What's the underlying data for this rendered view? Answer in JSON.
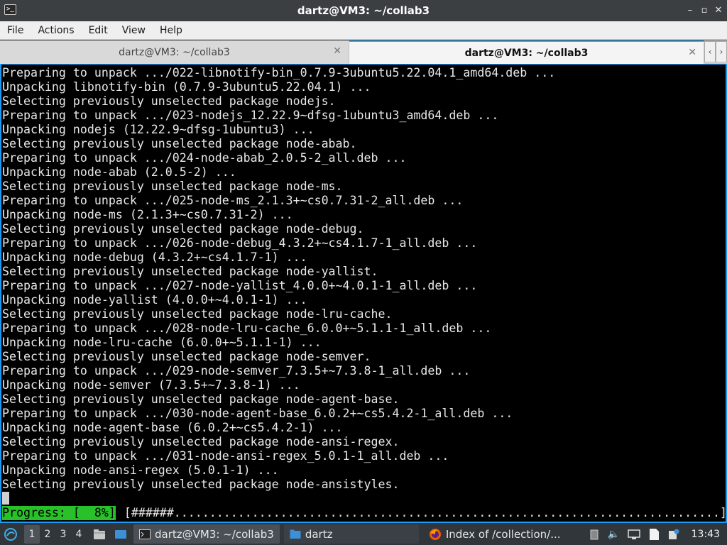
{
  "window": {
    "title": "dartz@VM3: ~/collab3",
    "controls": {
      "minimize": "–",
      "maximize": "▫",
      "close": "✕"
    }
  },
  "menu": [
    "File",
    "Actions",
    "Edit",
    "View",
    "Help"
  ],
  "tabs": [
    {
      "label": "dartz@VM3: ~/collab3",
      "active": false
    },
    {
      "label": "dartz@VM3: ~/collab3",
      "active": true
    }
  ],
  "tab_scroll": {
    "left": "‹",
    "right": "›"
  },
  "terminal": {
    "lines": [
      "Preparing to unpack .../022-libnotify-bin_0.7.9-3ubuntu5.22.04.1_amd64.deb ...",
      "Unpacking libnotify-bin (0.7.9-3ubuntu5.22.04.1) ...",
      "Selecting previously unselected package nodejs.",
      "Preparing to unpack .../023-nodejs_12.22.9~dfsg-1ubuntu3_amd64.deb ...",
      "Unpacking nodejs (12.22.9~dfsg-1ubuntu3) ...",
      "Selecting previously unselected package node-abab.",
      "Preparing to unpack .../024-node-abab_2.0.5-2_all.deb ...",
      "Unpacking node-abab (2.0.5-2) ...",
      "Selecting previously unselected package node-ms.",
      "Preparing to unpack .../025-node-ms_2.1.3+~cs0.7.31-2_all.deb ...",
      "Unpacking node-ms (2.1.3+~cs0.7.31-2) ...",
      "Selecting previously unselected package node-debug.",
      "Preparing to unpack .../026-node-debug_4.3.2+~cs4.1.7-1_all.deb ...",
      "Unpacking node-debug (4.3.2+~cs4.1.7-1) ...",
      "Selecting previously unselected package node-yallist.",
      "Preparing to unpack .../027-node-yallist_4.0.0+~4.0.1-1_all.deb ...",
      "Unpacking node-yallist (4.0.0+~4.0.1-1) ...",
      "Selecting previously unselected package node-lru-cache.",
      "Preparing to unpack .../028-node-lru-cache_6.0.0+~5.1.1-1_all.deb ...",
      "Unpacking node-lru-cache (6.0.0+~5.1.1-1) ...",
      "Selecting previously unselected package node-semver.",
      "Preparing to unpack .../029-node-semver_7.3.5+~7.3.8-1_all.deb ...",
      "Unpacking node-semver (7.3.5+~7.3.8-1) ...",
      "Selecting previously unselected package node-agent-base.",
      "Preparing to unpack .../030-node-agent-base_6.0.2+~cs5.4.2-1_all.deb ...",
      "Unpacking node-agent-base (6.0.2+~cs5.4.2-1) ...",
      "Selecting previously unselected package node-ansi-regex.",
      "Preparing to unpack .../031-node-ansi-regex_5.0.1-1_all.deb ...",
      "Unpacking node-ansi-regex (5.0.1-1) ...",
      "Selecting previously unselected package node-ansistyles."
    ],
    "progress_label": "Progress: [  8%]",
    "progress_bar": "[######.............................................................................]",
    "progress_percent": 8,
    "colors": {
      "background": "#000000",
      "text": "#e8e8e8",
      "progress": "#29c129",
      "focus_border": "#1d99f3"
    }
  },
  "taskbar": {
    "start_icon": "lubuntu-logo-icon",
    "desktops": [
      "1",
      "2",
      "3",
      "4"
    ],
    "current_desktop": "1",
    "quick_launch": [
      "file-manager-icon",
      "show-desktop-icon"
    ],
    "tasks": [
      {
        "label": "dartz@VM3: ~/collab3",
        "icon": "terminal-icon",
        "active": true
      },
      {
        "label": "dartz",
        "icon": "folder-icon",
        "active": false
      },
      {
        "label": "Index of /collection/...",
        "icon": "firefox-icon",
        "active": false
      }
    ],
    "tray": [
      "clipboard-icon",
      "volume-icon",
      "network-icon",
      "notes-icon",
      "update-notifier-icon"
    ],
    "clock": "13:43"
  }
}
